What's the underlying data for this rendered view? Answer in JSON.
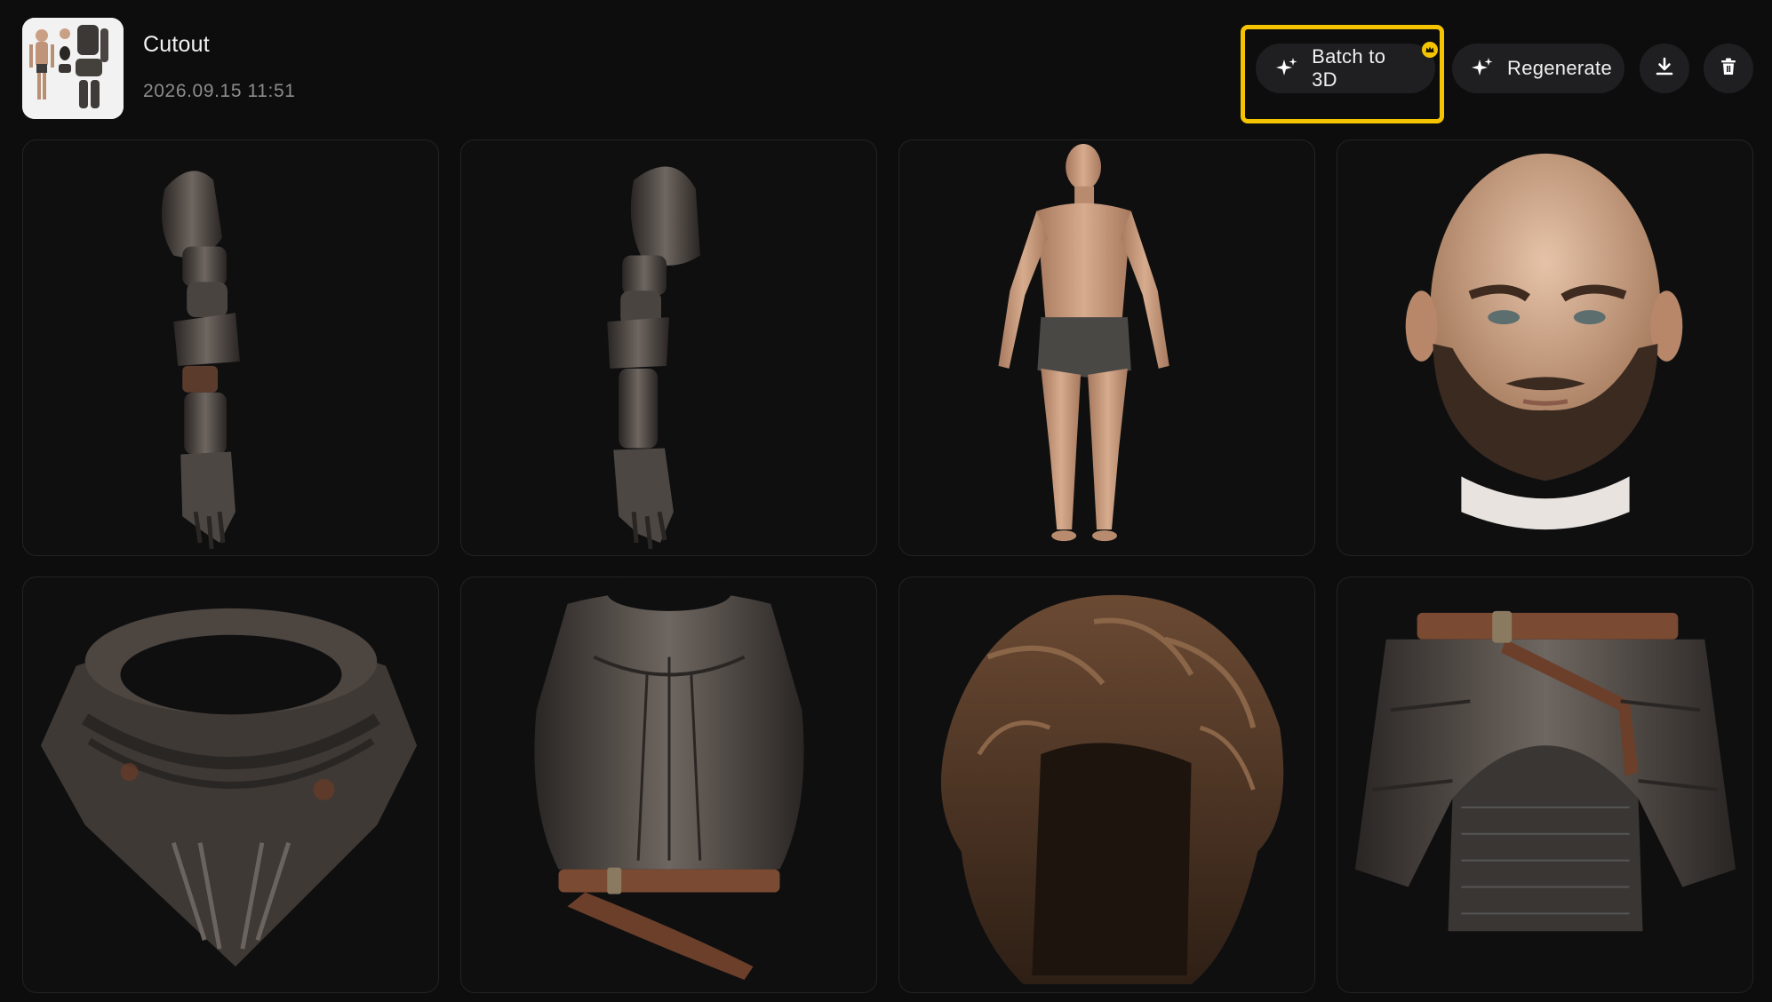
{
  "header": {
    "title": "Cutout",
    "date": "2026.09.15 11:51",
    "thumbnail_icon": "character-sheet-thumbnail"
  },
  "actions": {
    "batch_label": "Batch to 3D",
    "batch_icon": "sparkles-icon",
    "regenerate_label": "Regenerate",
    "regenerate_icon": "sparkles-icon",
    "download_icon": "download-icon",
    "delete_icon": "trash-icon",
    "highlight_color": "#f4c400",
    "premium_badge_icon": "crown-icon"
  },
  "colors": {
    "background": "#0d0d0e",
    "button": "#1f1f21",
    "card_border": "#232325"
  },
  "images": [
    {
      "name": "left-arm-armor-image",
      "subject": "armor-arm"
    },
    {
      "name": "right-arm-armor-image",
      "subject": "armor-arm"
    },
    {
      "name": "male-body-image",
      "subject": "body"
    },
    {
      "name": "bald-bearded-head-image",
      "subject": "head"
    },
    {
      "name": "gorget-collar-image",
      "subject": "gorget"
    },
    {
      "name": "breastplate-image",
      "subject": "breastplate"
    },
    {
      "name": "wavy-hair-image",
      "subject": "hair"
    },
    {
      "name": "tasset-skirt-image",
      "subject": "skirt"
    }
  ]
}
